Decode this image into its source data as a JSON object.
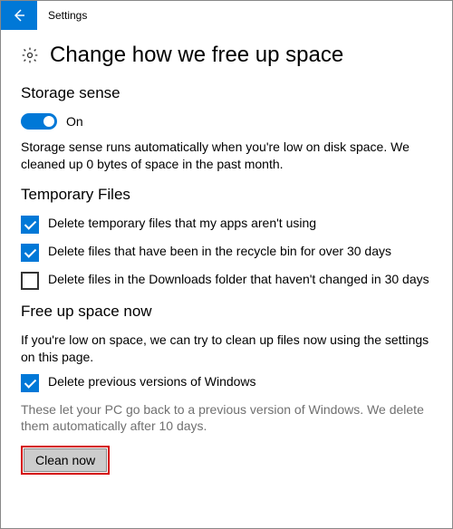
{
  "titlebar": {
    "title": "Settings"
  },
  "page": {
    "title": "Change how we free up space"
  },
  "storage_sense": {
    "heading": "Storage sense",
    "toggle_state": "On",
    "description": "Storage sense runs automatically when you're low on disk space. We cleaned up 0 bytes of space in the past month."
  },
  "temp_files": {
    "heading": "Temporary Files",
    "options": [
      {
        "label": "Delete temporary files that my apps aren't using",
        "checked": true
      },
      {
        "label": "Delete files that have been in the recycle bin for over 30 days",
        "checked": true
      },
      {
        "label": "Delete files in the Downloads folder that haven't changed in 30 days",
        "checked": false
      }
    ]
  },
  "free_up": {
    "heading": "Free up space now",
    "description": "If you're low on space, we can try to clean up files now using the settings on this page.",
    "option": {
      "label": "Delete previous versions of Windows",
      "checked": true
    },
    "note": "These let your PC go back to a previous version of Windows. We delete them automatically after 10 days.",
    "button": "Clean now"
  }
}
